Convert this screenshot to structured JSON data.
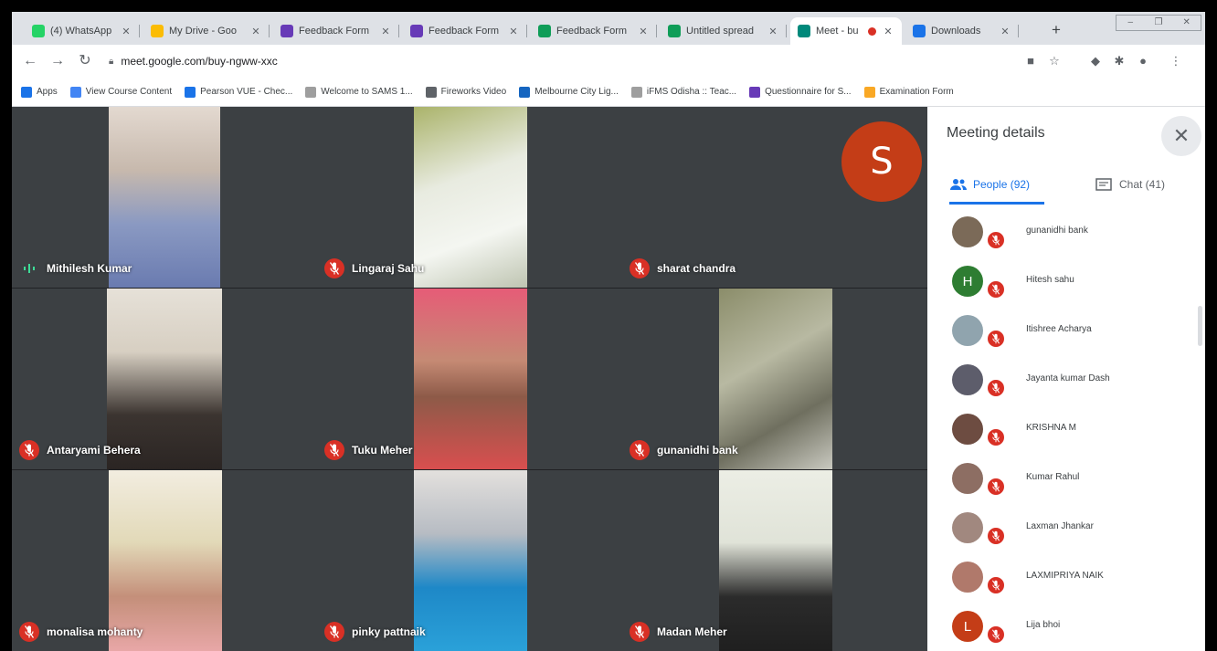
{
  "tabs": [
    {
      "title": "(4) WhatsApp",
      "icon": "whatsapp-icon",
      "color": "#25d366"
    },
    {
      "title": "My Drive - Goo",
      "icon": "drive-icon",
      "color": "#fbbc04"
    },
    {
      "title": "Feedback Form",
      "icon": "forms-icon",
      "color": "#673ab7"
    },
    {
      "title": "Feedback Form",
      "icon": "forms-icon",
      "color": "#673ab7"
    },
    {
      "title": "Feedback Form",
      "icon": "sheets-icon",
      "color": "#0f9d58"
    },
    {
      "title": "Untitled spread",
      "icon": "sheets-icon",
      "color": "#0f9d58"
    },
    {
      "title": "Meet - bu",
      "icon": "meet-icon",
      "color": "#00897b",
      "active": true
    },
    {
      "title": "Downloads",
      "icon": "download-icon",
      "color": "#1a73e8"
    }
  ],
  "address_bar": {
    "url": "meet.google.com/buy-ngww-xxc"
  },
  "bookmarks": [
    {
      "label": "Apps",
      "icon": "apps-icon",
      "color": "#1a73e8"
    },
    {
      "label": "View Course Content",
      "icon": "course-icon",
      "color": "#4285f4"
    },
    {
      "label": "Pearson VUE - Chec...",
      "icon": "pearson-icon",
      "color": "#1a73e8"
    },
    {
      "label": "Welcome to SAMS 1...",
      "icon": "sams-icon",
      "color": "#9e9e9e"
    },
    {
      "label": "Fireworks Video",
      "icon": "fireworks-icon",
      "color": "#5f6368"
    },
    {
      "label": "Melbourne City Lig...",
      "icon": "v-icon",
      "color": "#1565c0"
    },
    {
      "label": "iFMS Odisha :: Teac...",
      "icon": "ifms-icon",
      "color": "#9e9e9e"
    },
    {
      "label": "Questionnaire for S...",
      "icon": "forms-icon",
      "color": "#673ab7"
    },
    {
      "label": "Examination Form",
      "icon": "exam-icon",
      "color": "#f9a825"
    }
  ],
  "participants_grid": [
    {
      "name": "Mithilesh Kumar",
      "speaking": true
    },
    {
      "name": "Lingaraj Sahu",
      "speaking": false
    },
    {
      "name": "sharat chandra",
      "speaking": false,
      "avatar_letter": "S"
    },
    {
      "name": "Antaryami Behera",
      "speaking": false
    },
    {
      "name": "Tuku Meher",
      "speaking": false
    },
    {
      "name": "gunanidhi bank",
      "speaking": false
    },
    {
      "name": "monalisa mohanty",
      "speaking": false
    },
    {
      "name": "pinky pattnaik",
      "speaking": false
    },
    {
      "name": "Madan Meher",
      "speaking": false
    }
  ],
  "panel": {
    "title": "Meeting details",
    "people_tab": "People (92)",
    "chat_tab": "Chat (41)",
    "people": [
      {
        "name": "gunanidhi bank",
        "avatar_color": "#7b6a58"
      },
      {
        "name": "Hitesh sahu",
        "avatar_letter": "H",
        "avatar_color": "#2e7d32"
      },
      {
        "name": "Itishree Acharya",
        "avatar_color": "#90a4ae"
      },
      {
        "name": "Jayanta kumar Dash",
        "avatar_color": "#5d5d6b"
      },
      {
        "name": "KRISHNA M",
        "avatar_color": "#6d4c41"
      },
      {
        "name": "Kumar Rahul",
        "avatar_color": "#8d6e63"
      },
      {
        "name": "Laxman Jhankar",
        "avatar_color": "#a1887f"
      },
      {
        "name": "LAXMIPRIYA NAIK",
        "avatar_color": "#b0796b"
      },
      {
        "name": "Lija bhoi",
        "avatar_letter": "L",
        "avatar_color": "#c43d17"
      }
    ]
  },
  "colors": {
    "mute_red": "#d93025",
    "people_blue": "#1a73e8",
    "sharat_avatar": "#c43d17"
  }
}
